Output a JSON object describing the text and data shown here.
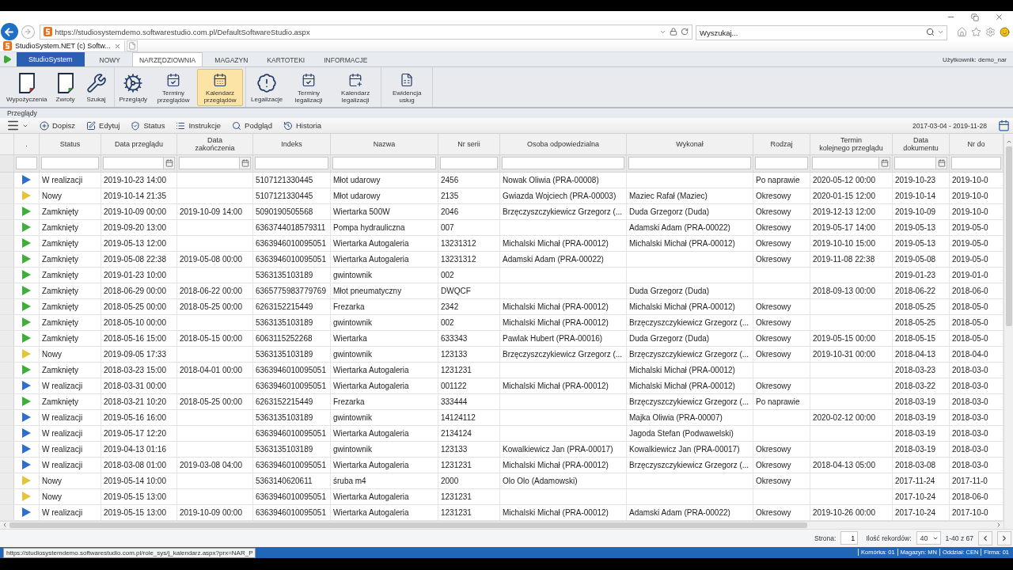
{
  "browser": {
    "address": "https://studiosystemdemo.softwarestudio.com.pl/DefaultSoftwareStudio.aspx",
    "search": {
      "placeholder": "Wyszukaj..."
    },
    "tab": {
      "title": "StudioSystem.NET (c) Softw..."
    }
  },
  "app_menu": {
    "brand": "StudioSystem",
    "tabs": [
      {
        "label": "NOWY",
        "selected": false
      },
      {
        "label": "NARZĘDZIOWNIA",
        "selected": true
      },
      {
        "label": "MAGAZYN",
        "selected": false
      },
      {
        "label": "KARTOTEKI",
        "selected": false
      },
      {
        "label": "INFORMACJE",
        "selected": false
      }
    ],
    "user": "Użytkownik: demo_nar"
  },
  "ribbon": {
    "groups": [
      {
        "items": [
          {
            "label": "Wypożyczenia",
            "selected": false
          },
          {
            "label": "Zwroty",
            "selected": false
          },
          {
            "label": "Szukaj",
            "selected": false
          }
        ]
      },
      {
        "items": [
          {
            "label": "Przeglądy",
            "selected": false
          },
          {
            "label": "Terminy przeglądów",
            "selected": false
          },
          {
            "label": "Kalendarz przeglądów",
            "selected": true
          }
        ]
      },
      {
        "items": [
          {
            "label": "Legalizacje",
            "selected": false
          },
          {
            "label": "Terminy legalizacji",
            "selected": false
          },
          {
            "label": "Kalendarz legalizacji",
            "selected": false
          }
        ]
      },
      {
        "items": [
          {
            "label": "Ewidencja usług",
            "selected": false
          }
        ]
      }
    ]
  },
  "breadcrumb": "Przeglądy",
  "toolbar": {
    "buttons": [
      "Dopisz",
      "Edytuj",
      "Status",
      "Instrukcje",
      "Podgląd",
      "Historia"
    ],
    "date_range": "2017-03-04 - 2019-11-28"
  },
  "table": {
    "columns": [
      {
        "label": ".",
        "kind": "text"
      },
      {
        "label": "Status",
        "kind": "text"
      },
      {
        "label": "Data przeglądu",
        "kind": "date"
      },
      {
        "label": "Data\nzakończenia",
        "kind": "date"
      },
      {
        "label": "Indeks",
        "kind": "text"
      },
      {
        "label": "Nazwa",
        "kind": "text"
      },
      {
        "label": "Nr serii",
        "kind": "text"
      },
      {
        "label": "Osoba odpowiedzialna",
        "kind": "text"
      },
      {
        "label": "Wykonał",
        "kind": "text"
      },
      {
        "label": "Rodzaj",
        "kind": "text"
      },
      {
        "label": "Termin\nkolejnego przeglądu",
        "kind": "date"
      },
      {
        "label": "Data\ndokumentu",
        "kind": "date"
      },
      {
        "label": "Nr do",
        "kind": "text"
      }
    ],
    "rows": [
      {
        "color": "#2f6fc6",
        "status": "W realizacji",
        "review_date": "2019-10-23 14:00",
        "index": "5107121330445",
        "name": "Młot udarowy",
        "serial_number": "2456",
        "responsible_person": "Nowak Oliwia (PRA-00008)",
        "type": "Po naprawie",
        "next_review_date": "2020-05-12 00:00",
        "document_date": "2019-10-23",
        "column_13": "2019-10-0"
      },
      {
        "color": "#e5c43c",
        "status": "Nowy",
        "review_date": "2019-10-14 21:35",
        "index": "5107121330445",
        "name": "Młot udarowy",
        "serial_number": "2135",
        "responsible_person": "Gwiazda Wojciech (PRA-00003)",
        "performed_by": "Maziec Rafał (Maziec)",
        "type": "Okresowy",
        "next_review_date": "2020-01-15 12:00",
        "document_date": "2019-10-14",
        "column_13": "2019-10-0"
      },
      {
        "color": "#3fae3a",
        "status": "Zamknięty",
        "review_date": "2019-10-09 00:00",
        "completion_date": "2019-10-09 14:00",
        "index": "5090190505568",
        "name": "Wiertarka 500W",
        "serial_number": "2046",
        "responsible_person": "Brzęczyszczykiewicz Grzegorz (...",
        "performed_by": "Duda Grzegorz (Duda)",
        "type": "Okresowy",
        "next_review_date": "2019-12-13 12:00",
        "document_date": "2019-10-09",
        "column_13": "2019-10-0"
      },
      {
        "color": "#3fae3a",
        "status": "Zamknięty",
        "review_date": "2019-09-20 13:00",
        "index": "6363744018579311",
        "name": "Pompa hydrauliczna",
        "serial_number": "007",
        "performed_by": "Adamski Adam (PRA-00022)",
        "type": "Okresowy",
        "next_review_date": "2019-05-17 14:00",
        "document_date": "2019-05-13",
        "column_13": "2019-05-0"
      },
      {
        "color": "#3fae3a",
        "status": "Zamknięty",
        "review_date": "2019-05-13 12:00",
        "index": "6363946010095051",
        "name": "Wiertarka Autogaleria",
        "serial_number": "13231312",
        "responsible_person": "Michalski Michał (PRA-00012)",
        "performed_by": "Michalski Michał (PRA-00012)",
        "type": "Okresowy",
        "next_review_date": "2019-10-10 15:00",
        "document_date": "2019-05-13",
        "column_13": "2019-05-0"
      },
      {
        "color": "#3fae3a",
        "status": "Zamknięty",
        "review_date": "2019-05-08 22:38",
        "completion_date": "2019-05-08 00:00",
        "index": "6363946010095051",
        "name": "Wiertarka Autogaleria",
        "serial_number": "13231312",
        "responsible_person": "Adamski Adam (PRA-00022)",
        "type": "Okresowy",
        "next_review_date": "2019-11-08 22:38",
        "document_date": "2019-05-08",
        "column_13": "2019-05-0"
      },
      {
        "color": "#3fae3a",
        "status": "Zamknięty",
        "review_date": "2019-01-23 10:00",
        "index": "5363135103189",
        "name": "gwintownik",
        "serial_number": "002",
        "document_date": "2019-01-23",
        "column_13": "2019-01-0"
      },
      {
        "color": "#3fae3a",
        "status": "Zamknięty",
        "review_date": "2018-06-29 00:00",
        "completion_date": "2018-06-22 00:00",
        "index": "6365775983779769",
        "name": "Młot pneumatyczny",
        "serial_number": "DWQCF",
        "performed_by": "Duda Grzegorz (Duda)",
        "next_review_date": "2018-09-13 00:00",
        "document_date": "2018-06-22",
        "column_13": "2018-06-0"
      },
      {
        "color": "#3fae3a",
        "status": "Zamknięty",
        "review_date": "2018-05-25 00:00",
        "completion_date": "2018-05-25 00:00",
        "index": "6263152215449",
        "name": "Frezarka",
        "serial_number": "2342",
        "responsible_person": "Michalski Michał (PRA-00012)",
        "performed_by": "Michalski Michał (PRA-00012)",
        "type": "Okresowy",
        "document_date": "2018-05-25",
        "column_13": "2018-05-0"
      },
      {
        "color": "#3fae3a",
        "status": "Zamknięty",
        "review_date": "2018-05-10 00:00",
        "index": "5363135103189",
        "name": "gwintownik",
        "serial_number": "002",
        "responsible_person": "Michalski Michał (PRA-00012)",
        "performed_by": "Brzęczyszczykiewicz Grzegorz (...",
        "type": "Okresowy",
        "document_date": "2018-05-25",
        "column_13": "2018-05-0"
      },
      {
        "color": "#3fae3a",
        "status": "Zamknięty",
        "review_date": "2018-05-16 15:00",
        "completion_date": "2018-05-15 00:00",
        "index": "6063115252268",
        "name": "Wiertarka",
        "serial_number": "633343",
        "responsible_person": "Pawlak Hubert (PRA-00016)",
        "performed_by": "Duda Grzegorz (Duda)",
        "type": "Okresowy",
        "next_review_date": "2019-05-15 00:00",
        "document_date": "2018-05-15",
        "column_13": "2018-05-0"
      },
      {
        "color": "#e5c43c",
        "status": "Nowy",
        "review_date": "2019-09-05 17:33",
        "index": "5363135103189",
        "name": "gwintownik",
        "serial_number": "123133",
        "responsible_person": "Brzęczyszczykiewicz Grzegorz (...",
        "performed_by": "Brzęczyszczykiewicz Grzegorz (...",
        "type": "Okresowy",
        "next_review_date": "2019-10-31 00:00",
        "document_date": "2018-04-13",
        "column_13": "2018-04-0"
      },
      {
        "color": "#3fae3a",
        "status": "Zamknięty",
        "review_date": "2018-03-23 15:00",
        "completion_date": "2018-04-01 00:00",
        "index": "6363946010095051",
        "name": "Wiertarka Autogaleria",
        "serial_number": "1231231",
        "performed_by": "Michalski Michał (PRA-00012)",
        "document_date": "2018-03-23",
        "column_13": "2018-03-0"
      },
      {
        "color": "#2f6fc6",
        "status": "W realizacji",
        "review_date": "2018-03-31 00:00",
        "index": "6363946010095051",
        "name": "Wiertarka Autogaleria",
        "serial_number": "001122",
        "responsible_person": "Michalski Michał (PRA-00012)",
        "performed_by": "Michalski Michał (PRA-00012)",
        "type": "Okresowy",
        "document_date": "2018-03-22",
        "column_13": "2018-03-0"
      },
      {
        "color": "#3fae3a",
        "status": "Zamknięty",
        "review_date": "2018-03-21 10:20",
        "completion_date": "2018-05-25 00:00",
        "index": "6263152215449",
        "name": "Frezarka",
        "serial_number": "333444",
        "performed_by": "Brzęczyszczykiewicz Grzegorz (...",
        "type": "Po naprawie",
        "document_date": "2018-03-19",
        "column_13": "2018-03-0"
      },
      {
        "color": "#2f6fc6",
        "status": "W realizacji",
        "review_date": "2019-05-16 16:00",
        "index": "5363135103189",
        "name": "gwintownik",
        "serial_number": "14124112",
        "performed_by": "Majka Oliwia (PRA-00007)",
        "next_review_date": "2020-02-12 00:00",
        "document_date": "2018-03-19",
        "column_13": "2018-03-0"
      },
      {
        "color": "#2f6fc6",
        "status": "W realizacji",
        "review_date": "2019-05-17 12:20",
        "index": "6363946010095051",
        "name": "Wiertarka Autogaleria",
        "serial_number": "2134124",
        "performed_by": "Jagoda Stefan (Podwawelski)",
        "document_date": "2018-03-19",
        "column_13": "2018-03-0"
      },
      {
        "color": "#2f6fc6",
        "status": "W realizacji",
        "review_date": "2019-04-13 01:16",
        "index": "5363135103189",
        "name": "gwintownik",
        "serial_number": "123133",
        "responsible_person": "Kowalkiewicz Jan (PRA-00017)",
        "performed_by": "Kowalkiewicz Jan (PRA-00017)",
        "type": "Okresowy",
        "document_date": "2018-03-19",
        "column_13": "2018-03-0"
      },
      {
        "color": "#2f6fc6",
        "status": "W realizacji",
        "review_date": "2018-03-08 01:00",
        "completion_date": "2019-03-08 04:00",
        "index": "6363946010095051",
        "name": "Wiertarka Autogaleria",
        "serial_number": "1231231",
        "responsible_person": "Michalski Michał (PRA-00012)",
        "performed_by": "Brzęczyszczykiewicz Grzegorz (...",
        "type": "Okresowy",
        "next_review_date": "2018-04-13 05:00",
        "document_date": "2018-03-08",
        "column_13": "2018-03-0"
      },
      {
        "color": "#e5c43c",
        "status": "Nowy",
        "review_date": "2019-05-14 10:00",
        "index": "5363140620611",
        "name": "śruba m4",
        "serial_number": "2000",
        "responsible_person": "Olo Olo (Adamowski)",
        "type": "Okresowy",
        "document_date": "2017-11-24",
        "column_13": "2017-11-0"
      },
      {
        "color": "#e5c43c",
        "status": "Nowy",
        "review_date": "2019-05-15 13:00",
        "index": "6363946010095051",
        "name": "Wiertarka Autogaleria",
        "serial_number": "1231231",
        "document_date": "2017-10-24",
        "column_13": "2018-06-0"
      },
      {
        "color": "#2f6fc6",
        "status": "W realizacji",
        "review_date": "2019-05-15 13:00",
        "completion_date": "2019-10-09 00:00",
        "index": "6363946010095051",
        "name": "Wiertarka Autogaleria",
        "serial_number": "1231231",
        "responsible_person": "Michalski Michał (PRA-00012)",
        "performed_by": "Adamski Adam (PRA-00022)",
        "type": "Okresowy",
        "next_review_date": "2019-10-26 00:00",
        "document_date": "2017-10-24",
        "column_13": "2017-10-0"
      }
    ]
  },
  "pagination": {
    "page_label": "Strona:",
    "page": "1",
    "size_label": "Ilość rekordów:",
    "size": "40",
    "range": "1-40 z 67"
  },
  "status_bar": {
    "items": [
      "Komórka: 01",
      "Magazyn: MN",
      "Oddział: CEN",
      "Firma: 01"
    ],
    "link_preview": "https://studiosystemdemo.softwarestudio.com.pl/role_sys/j_kalendarz.aspx?prx=NAR_P"
  }
}
